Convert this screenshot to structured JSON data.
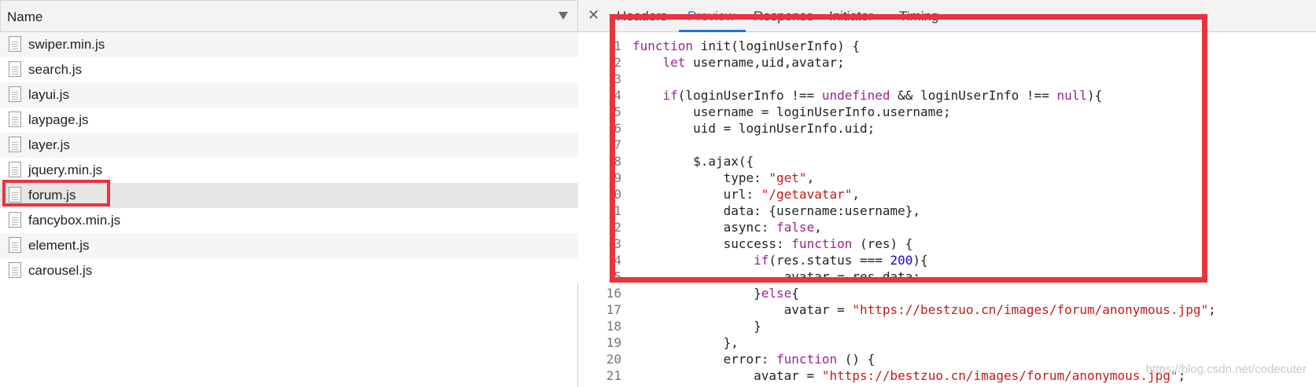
{
  "left_panel": {
    "header": "Name",
    "files": [
      "swiper.min.js",
      "search.js",
      "layui.js",
      "laypage.js",
      "layer.js",
      "jquery.min.js",
      "forum.js",
      "fancybox.min.js",
      "element.js",
      "carousel.js"
    ],
    "selected": "forum.js"
  },
  "right_panel": {
    "tabs": [
      "Headers",
      "Preview",
      "Response",
      "Initiator",
      "Timing"
    ],
    "active_tab": "Preview",
    "code_lines": [
      {
        "n": "1",
        "t": "function init(loginUserInfo) {"
      },
      {
        "n": "2",
        "t": "    let username,uid,avatar;"
      },
      {
        "n": "3",
        "t": ""
      },
      {
        "n": "4",
        "t": "    if(loginUserInfo !== undefined && loginUserInfo !== null){"
      },
      {
        "n": "5",
        "t": "        username = loginUserInfo.username;"
      },
      {
        "n": "6",
        "t": "        uid = loginUserInfo.uid;"
      },
      {
        "n": "7",
        "t": ""
      },
      {
        "n": "8",
        "t": "        $.ajax({"
      },
      {
        "n": "9",
        "t": "            type: \"get\","
      },
      {
        "n": "0",
        "t": "            url: \"/getavatar\","
      },
      {
        "n": "1",
        "t": "            data: {username:username},"
      },
      {
        "n": "2",
        "t": "            async: false,"
      },
      {
        "n": "3",
        "t": "            success: function (res) {"
      },
      {
        "n": "4",
        "t": "                if(res.status === 200){"
      },
      {
        "n": "5",
        "t": "                    avatar = res.data;"
      },
      {
        "n": "16",
        "t": "                }else{"
      },
      {
        "n": "17",
        "t": "                    avatar = \"https://bestzuo.cn/images/forum/anonymous.jpg\";"
      },
      {
        "n": "18",
        "t": "                }"
      },
      {
        "n": "19",
        "t": "            },"
      },
      {
        "n": "20",
        "t": "            error: function () {"
      },
      {
        "n": "21",
        "t": "                avatar = \"https://bestzuo.cn/images/forum/anonymous.jpg\";"
      }
    ],
    "watermark": "https://blog.csdn.net/codecuter"
  },
  "colors": {
    "highlight": "#e7343f",
    "active_tab": "#1a73e8",
    "keyword": "#9b2393",
    "string": "#c41a16"
  },
  "icons": [
    "file-icon",
    "close-icon",
    "sort-arrow-icon"
  ]
}
